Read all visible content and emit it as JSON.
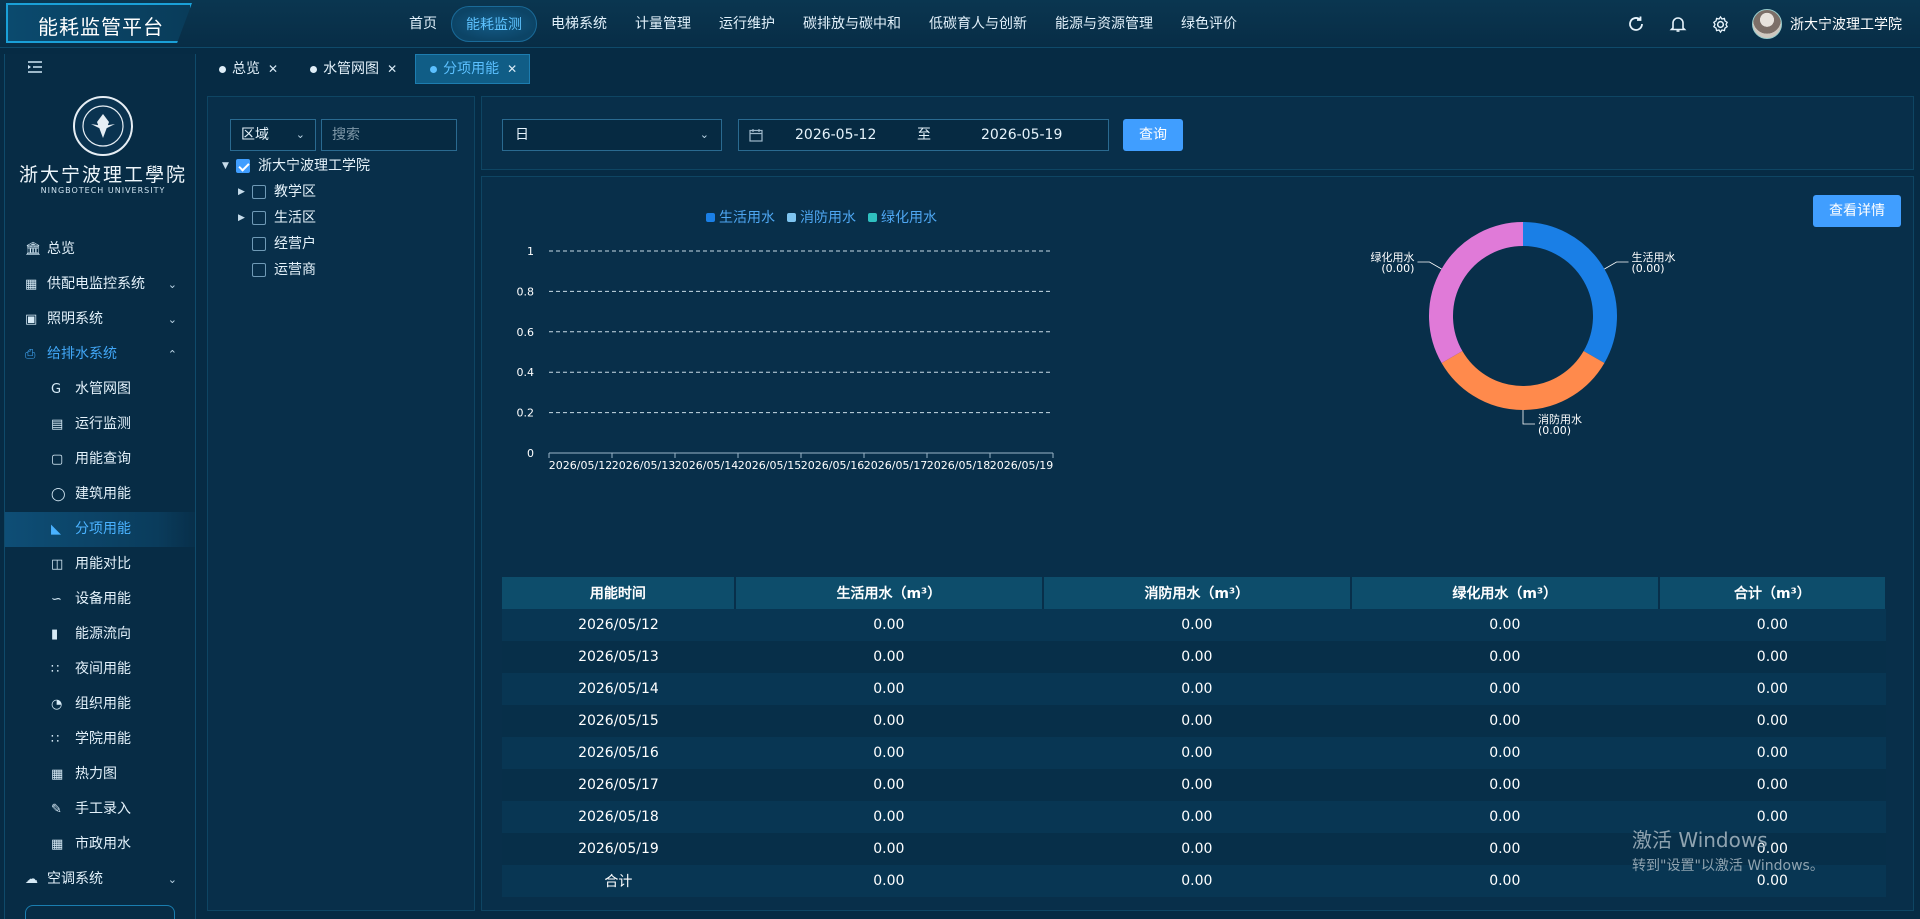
{
  "app": {
    "title": "能耗监管平台"
  },
  "nav": [
    {
      "label": "首页",
      "active": false
    },
    {
      "label": "能耗监测",
      "active": true
    },
    {
      "label": "电梯系统",
      "active": false
    },
    {
      "label": "计量管理",
      "active": false
    },
    {
      "label": "运行维护",
      "active": false
    },
    {
      "label": "碳排放与碳中和",
      "active": false
    },
    {
      "label": "低碳育人与创新",
      "active": false
    },
    {
      "label": "能源与资源管理",
      "active": false
    },
    {
      "label": "绿色评价",
      "active": false
    }
  ],
  "user": {
    "name": "浙大宁波理工学院"
  },
  "school": {
    "name": "浙大宁波理工學院",
    "name_en": "NINGBOTECH UNIVERSITY"
  },
  "sidebar": {
    "items": [
      {
        "label": "总览",
        "icon": "bank-icon",
        "type": "top"
      },
      {
        "label": "供配电监控系统",
        "icon": "grid-icon",
        "type": "top",
        "chevron": "down"
      },
      {
        "label": "照明系统",
        "icon": "laptop-icon",
        "type": "top",
        "chevron": "down"
      },
      {
        "label": "给排水系统",
        "icon": "document-icon",
        "type": "open",
        "chevron": "up"
      },
      {
        "label": "水管网图",
        "icon": "g-icon",
        "type": "sub"
      },
      {
        "label": "运行监测",
        "icon": "list-icon",
        "type": "sub"
      },
      {
        "label": "用能查询",
        "icon": "monitor-icon",
        "type": "sub"
      },
      {
        "label": "建筑用能",
        "icon": "presentation-icon",
        "type": "sub"
      },
      {
        "label": "分项用能",
        "icon": "area-chart-icon",
        "type": "active"
      },
      {
        "label": "用能对比",
        "icon": "compare-icon",
        "type": "sub"
      },
      {
        "label": "设备用能",
        "icon": "line-chart-icon",
        "type": "sub"
      },
      {
        "label": "能源流向",
        "icon": "bar-chart-icon",
        "type": "sub"
      },
      {
        "label": "夜间用能",
        "icon": "scatter-icon",
        "type": "sub"
      },
      {
        "label": "组织用能",
        "icon": "pie-icon",
        "type": "sub"
      },
      {
        "label": "学院用能",
        "icon": "scatter-icon",
        "type": "sub"
      },
      {
        "label": "热力图",
        "icon": "table-icon",
        "type": "sub"
      },
      {
        "label": "手工录入",
        "icon": "pen-icon",
        "type": "sub"
      },
      {
        "label": "市政用水",
        "icon": "apps-icon",
        "type": "sub"
      },
      {
        "label": "空调系统",
        "icon": "cloud-icon",
        "type": "top",
        "chevron": "down"
      }
    ]
  },
  "tabs": [
    {
      "label": "总览",
      "active": false
    },
    {
      "label": "水管网图",
      "active": false
    },
    {
      "label": "分项用能",
      "active": true
    }
  ],
  "tree_panel": {
    "region": "区域",
    "search_placeholder": "搜索",
    "nodes": [
      {
        "label": "浙大宁波理工学院",
        "level": 0,
        "arrow": "down",
        "checked": true
      },
      {
        "label": "教学区",
        "level": 1,
        "arrow": "right",
        "checked": false
      },
      {
        "label": "生活区",
        "level": 1,
        "arrow": "right",
        "checked": false
      },
      {
        "label": "经营户",
        "level": 1,
        "arrow": "",
        "checked": false
      },
      {
        "label": "运营商",
        "level": 1,
        "arrow": "",
        "checked": false
      }
    ]
  },
  "filter": {
    "period": "日",
    "start_date": "2026-05-12",
    "to_label": "至",
    "end_date": "2026-05-19",
    "query_label": "查询"
  },
  "detail_label": "查看详情",
  "colors": {
    "domestic": "#1a7fe6",
    "fire": "#ff8a4c",
    "greening": "#e07ad8",
    "legend_fire": "#7ec4f0",
    "legend_green": "#2fc0c0"
  },
  "chart_data": [
    {
      "type": "bar",
      "title": "",
      "categories": [
        "2026/05/12",
        "2026/05/13",
        "2026/05/14",
        "2026/05/15",
        "2026/05/16",
        "2026/05/17",
        "2026/05/18",
        "2026/05/19"
      ],
      "series": [
        {
          "name": "生活用水",
          "values": [
            0,
            0,
            0,
            0,
            0,
            0,
            0,
            0
          ]
        },
        {
          "name": "消防用水",
          "values": [
            0,
            0,
            0,
            0,
            0,
            0,
            0,
            0
          ]
        },
        {
          "name": "绿化用水",
          "values": [
            0,
            0,
            0,
            0,
            0,
            0,
            0,
            0
          ]
        }
      ],
      "yticks": [
        "0",
        "0.2",
        "0.4",
        "0.6",
        "0.8",
        "1"
      ],
      "ylim": [
        0,
        1
      ],
      "grid": true,
      "legend": "top"
    },
    {
      "type": "pie",
      "title": "",
      "slices": [
        {
          "name": "生活用水",
          "value": 0,
          "label": "(0.00)"
        },
        {
          "name": "消防用水",
          "value": 0,
          "label": "(0.00)"
        },
        {
          "name": "绿化用水",
          "value": 0,
          "label": "(0.00)"
        }
      ]
    }
  ],
  "table": {
    "headers": [
      "用能时间",
      "生活用水（m³）",
      "消防用水（m³）",
      "绿化用水（m³）",
      "合计（m³）"
    ],
    "rows": [
      [
        "2026/05/12",
        "0.00",
        "0.00",
        "0.00",
        "0.00"
      ],
      [
        "2026/05/13",
        "0.00",
        "0.00",
        "0.00",
        "0.00"
      ],
      [
        "2026/05/14",
        "0.00",
        "0.00",
        "0.00",
        "0.00"
      ],
      [
        "2026/05/15",
        "0.00",
        "0.00",
        "0.00",
        "0.00"
      ],
      [
        "2026/05/16",
        "0.00",
        "0.00",
        "0.00",
        "0.00"
      ],
      [
        "2026/05/17",
        "0.00",
        "0.00",
        "0.00",
        "0.00"
      ],
      [
        "2026/05/18",
        "0.00",
        "0.00",
        "0.00",
        "0.00"
      ],
      [
        "2026/05/19",
        "0.00",
        "0.00",
        "0.00",
        "0.00"
      ],
      [
        "合计",
        "0.00",
        "0.00",
        "0.00",
        "0.00"
      ]
    ]
  },
  "watermark": {
    "line1": "激活 Windows",
    "line2": "转到\"设置\"以激活 Windows。"
  }
}
